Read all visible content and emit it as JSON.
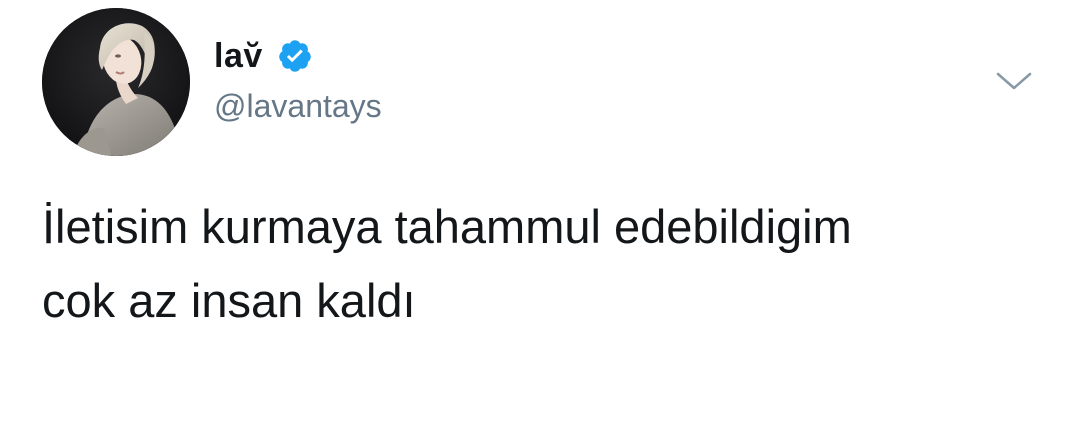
{
  "author": {
    "display_name": "lav̆",
    "handle": "@lavantays",
    "verified": true,
    "verified_icon": "verified-badge-icon",
    "avatar_icon": "profile-photo"
  },
  "tweet": {
    "lines": [
      "İletisim kurmaya tahammul edebildigim",
      "cok az insan kaldı"
    ]
  },
  "menu_icon": "chevron-down-icon",
  "colors": {
    "text": "#14171a",
    "secondary": "#657786",
    "verified": "#1da1f2",
    "background": "#ffffff"
  }
}
